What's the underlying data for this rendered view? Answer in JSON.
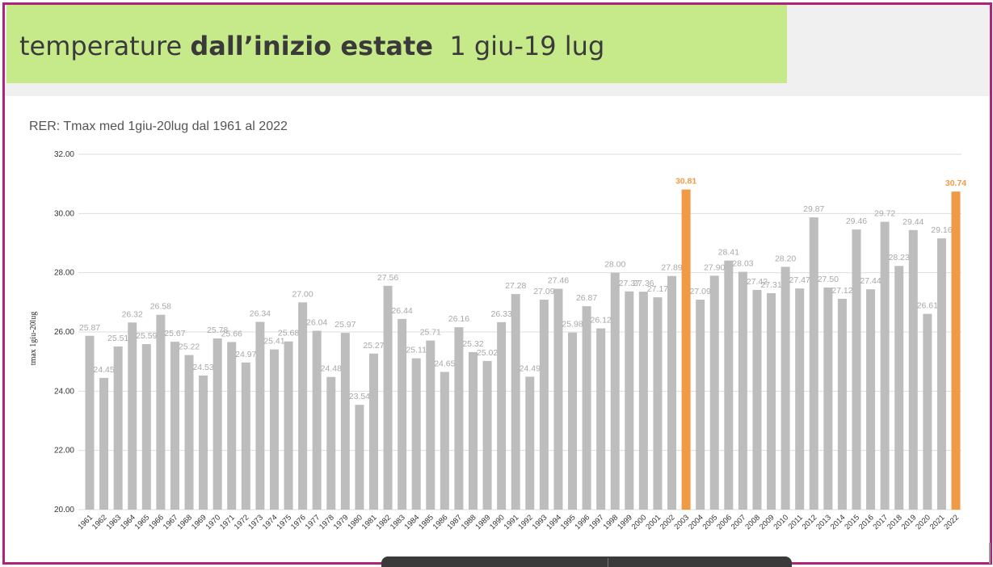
{
  "banner": {
    "title_regular": "temperature ",
    "title_bold": "dall’inizio estate",
    "title_suffix": "  1 giu-19 lug"
  },
  "chart_data": {
    "type": "bar",
    "title": "RER: Tmax med 1giu-20lug dal 1961 al 2022",
    "ylabel": "tmax 1giu-20lug",
    "xlabel": "",
    "ylim": [
      20,
      32
    ],
    "yticks": [
      "20.00",
      "22.00",
      "24.00",
      "26.00",
      "28.00",
      "30.00",
      "32.00"
    ],
    "grid": true,
    "categories": [
      "1961",
      "1962",
      "1963",
      "1964",
      "1965",
      "1966",
      "1967",
      "1968",
      "1969",
      "1970",
      "1971",
      "1972",
      "1973",
      "1974",
      "1975",
      "1976",
      "1977",
      "1978",
      "1979",
      "1980",
      "1981",
      "1982",
      "1983",
      "1984",
      "1985",
      "1986",
      "1987",
      "1988",
      "1989",
      "1990",
      "1991",
      "1992",
      "1993",
      "1994",
      "1995",
      "1996",
      "1997",
      "1998",
      "1999",
      "2000",
      "2001",
      "2002",
      "2003",
      "2004",
      "2005",
      "2006",
      "2007",
      "2008",
      "2009",
      "2010",
      "2011",
      "2012",
      "2013",
      "2014",
      "2015",
      "2016",
      "2017",
      "2018",
      "2019",
      "2020",
      "2021",
      "2022"
    ],
    "values": [
      25.87,
      24.45,
      25.51,
      26.32,
      25.59,
      26.58,
      25.67,
      25.22,
      24.53,
      25.78,
      25.66,
      24.97,
      26.34,
      25.41,
      25.68,
      27.0,
      26.04,
      24.48,
      25.97,
      23.54,
      25.27,
      27.56,
      26.44,
      25.11,
      25.71,
      24.65,
      26.16,
      25.32,
      25.02,
      26.33,
      27.28,
      24.49,
      27.09,
      27.46,
      25.98,
      26.87,
      26.12,
      28.0,
      27.37,
      27.36,
      27.17,
      27.89,
      30.81,
      27.09,
      27.9,
      28.41,
      28.03,
      27.42,
      27.31,
      28.2,
      27.47,
      29.87,
      27.5,
      27.12,
      29.46,
      27.44,
      29.72,
      28.23,
      29.44,
      26.61,
      29.16,
      30.74
    ],
    "highlight": [
      "2003",
      "2022"
    ],
    "colors": {
      "bar": "#bdbdbd",
      "highlight": "#f09a45",
      "label": "#a8a8a8",
      "highlight_label": "#f09a45",
      "grid": "#dddddd"
    }
  }
}
